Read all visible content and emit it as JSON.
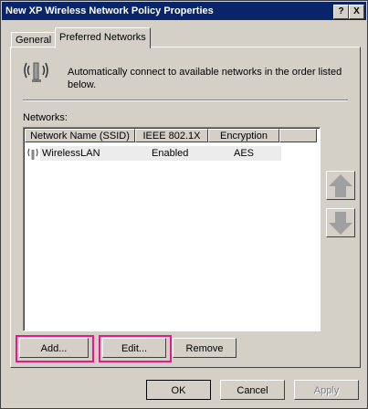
{
  "window": {
    "title": "New XP Wireless Network Policy Properties",
    "help_label": "?",
    "close_label": "X"
  },
  "tabs": [
    {
      "label": "General"
    },
    {
      "label": "Preferred Networks"
    }
  ],
  "description": "Automatically connect to available networks in the order listed below.",
  "networks_label": "Networks:",
  "list": {
    "columns": [
      "Network Name (SSID)",
      "IEEE 802.1X",
      "Encryption"
    ],
    "rows": [
      {
        "ssid": "WirelessLAN",
        "ieee": "Enabled",
        "encryption": "AES"
      }
    ]
  },
  "buttons": {
    "add": "Add...",
    "edit": "Edit...",
    "remove": "Remove",
    "ok": "OK",
    "cancel": "Cancel",
    "apply": "Apply"
  },
  "highlight_color": "#e6198f",
  "title_bar_color": "#0a246a"
}
